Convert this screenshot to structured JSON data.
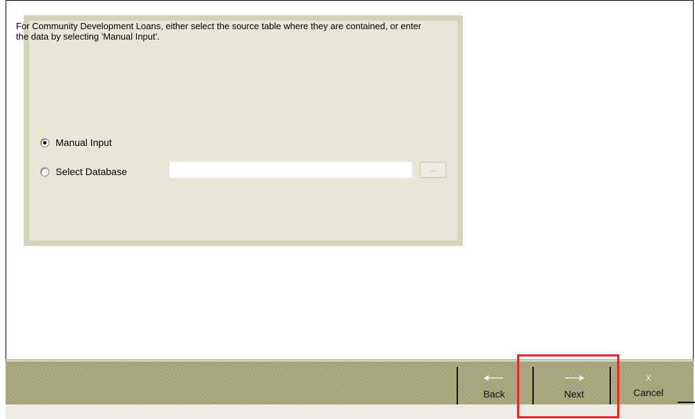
{
  "panel": {
    "instructions": "For Community Development Loans, either select the source table where they are contained, or enter the data by selecting 'Manual Input'.",
    "options": [
      {
        "label": "Manual Input",
        "checked": true
      },
      {
        "label": "Select Database",
        "checked": false
      }
    ],
    "database_path": "",
    "browse_label": "..."
  },
  "toolbar": {
    "back_label": "Back",
    "next_label": "Next",
    "cancel_label": "Cancel",
    "cancel_icon": "X"
  },
  "colors": {
    "panel_border": "#d6d3bd",
    "panel_fill": "#e8e6d7",
    "toolbar": "#a8a67b",
    "highlight": "#e8252c"
  }
}
